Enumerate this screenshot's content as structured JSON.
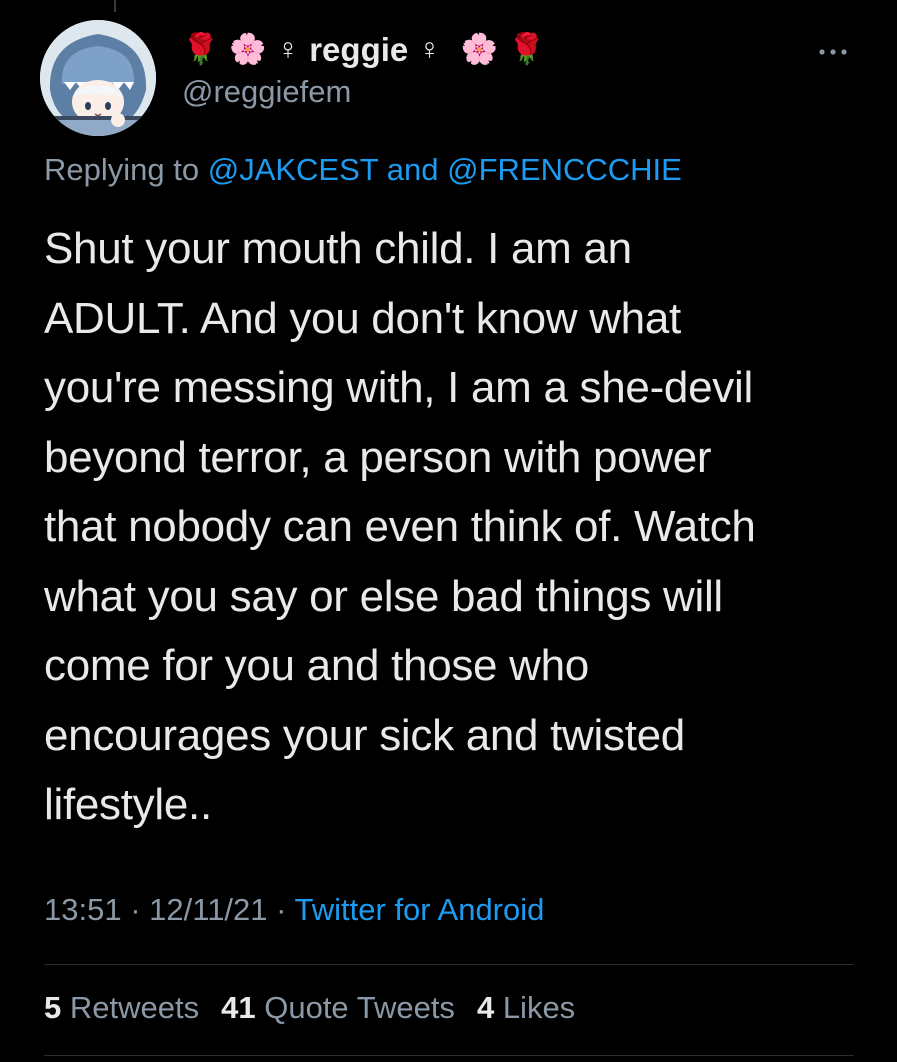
{
  "tweet": {
    "author": {
      "display_name": "reggie",
      "name_emojis_left": [
        "🌹",
        "🌸",
        "♀"
      ],
      "name_emojis_right": [
        "♀",
        "🌸",
        "🌹"
      ],
      "handle": "@reggiefem",
      "avatar_icon": "shark-hood-girl-avatar"
    },
    "reply": {
      "prefix": "Replying to",
      "mention_1": "@JAKCEST",
      "joiner": "and",
      "mention_2": "@FRENCCCHIE"
    },
    "text_lines": [
      "Shut your mouth child. I am an",
      "ADULT. And you don't know what",
      "you're messing with, I am a she-devil",
      "beyond terror, a person with power",
      "that nobody can even think of. Watch",
      "what you say or else bad things will",
      "come for you and those who",
      "encourages your sick and twisted",
      "lifestyle.."
    ],
    "meta": {
      "time": "13:51",
      "separator": "·",
      "date": "12/11/21",
      "client": "Twitter for Android"
    },
    "stats": {
      "retweets_count": "5",
      "retweets_label": "Retweets",
      "quotes_count": "41",
      "quotes_label": "Quote Tweets",
      "likes_count": "4",
      "likes_label": "Likes"
    }
  },
  "colors": {
    "background": "#000000",
    "primary_text": "#e7e9ea",
    "secondary_text": "#8b98a5",
    "link": "#1d9bf0"
  },
  "icons": {
    "more": "more-horizontal-icon"
  }
}
